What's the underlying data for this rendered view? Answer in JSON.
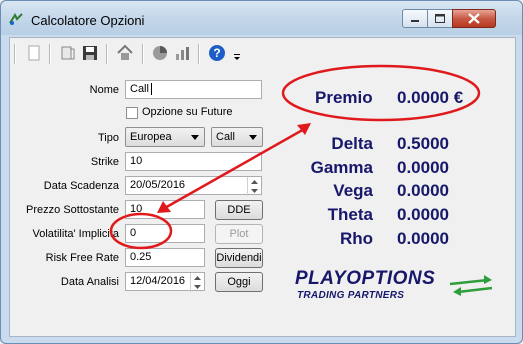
{
  "window": {
    "title": "Calcolatore Opzioni"
  },
  "toolbar": {
    "icons": [
      "new-icon",
      "open-icon",
      "save-icon",
      "home-icon",
      "chart-icon",
      "bars-icon",
      "help-icon",
      "dropdown-icon"
    ]
  },
  "form": {
    "nome_label": "Nome",
    "nome_value": "Call",
    "future_label": "Opzione su Future",
    "tipo_label": "Tipo",
    "tipo_style": "Europea",
    "tipo_kind": "Call",
    "strike_label": "Strike",
    "strike_value": "10",
    "scadenza_label": "Data Scadenza",
    "scadenza_value": "20/05/2016",
    "sottostante_label": "Prezzo Sottostante",
    "sottostante_value": "10",
    "dde_button": "DDE",
    "volatilita_label": "Volatilita' Implicita",
    "volatilita_value": "0",
    "plot_button": "Plot",
    "riskfree_label": "Risk Free Rate",
    "riskfree_value": "0.25",
    "dividendi_button": "Dividendi",
    "analisi_label": "Data Analisi",
    "analisi_value": "12/04/2016",
    "oggi_button": "Oggi"
  },
  "results": {
    "premio_label": "Premio",
    "premio_value": "0.0000 €",
    "delta_label": "Delta",
    "delta_value": "0.5000",
    "gamma_label": "Gamma",
    "gamma_value": "0.0000",
    "vega_label": "Vega",
    "vega_value": "0.0000",
    "theta_label": "Theta",
    "theta_value": "0.0000",
    "rho_label": "Rho",
    "rho_value": "0.0000"
  },
  "logo": {
    "line1": "PLAYOPTIONS",
    "line2": "TRADING PARTNERS"
  },
  "colors": {
    "annotation_red": "#e0191c",
    "result_text": "#17176b",
    "logo_green": "#2e9e3c"
  }
}
